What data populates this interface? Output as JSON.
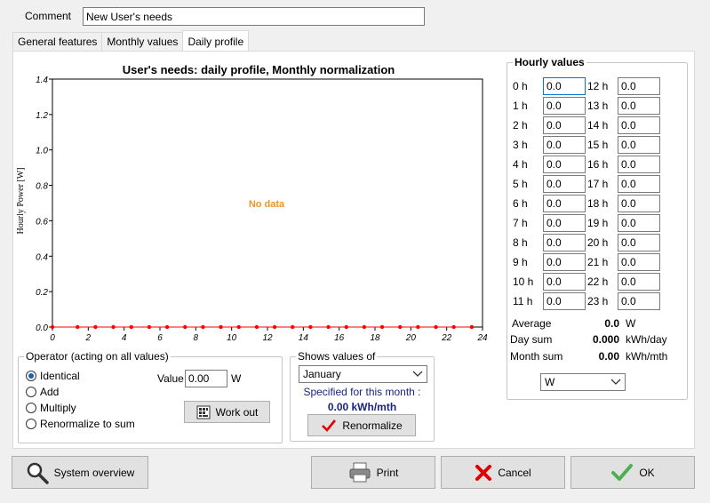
{
  "comment": {
    "label": "Comment",
    "value": "New User's needs"
  },
  "tabs": [
    {
      "label": "General features"
    },
    {
      "label": "Monthly values"
    },
    {
      "label": "Daily profile"
    }
  ],
  "chart_data": {
    "type": "line",
    "title": "User's needs: daily profile, Monthly normalization",
    "xlabel": "",
    "ylabel": "Hourly Power [W]",
    "xlim": [
      0,
      24
    ],
    "ylim": [
      0.0,
      1.4
    ],
    "x_ticks": [
      "0",
      "2",
      "4",
      "6",
      "8",
      "10",
      "12",
      "14",
      "16",
      "18",
      "20",
      "22",
      "24"
    ],
    "y_ticks": [
      "0.0",
      "0.2",
      "0.4",
      "0.6",
      "0.8",
      "1.0",
      "1.2",
      "1.4"
    ],
    "annotation": "No data",
    "series": [
      {
        "x": [
          0,
          1.4,
          2.4,
          3.4,
          4.4,
          5.4,
          6.4,
          7.4,
          8.4,
          9.4,
          10.4,
          11.4,
          12.4,
          13.4,
          14.4,
          15.4,
          16.4,
          17.4,
          18.4,
          19.4,
          20.4,
          21.4,
          22.4,
          23.4
        ],
        "values": [
          0,
          0,
          0,
          0,
          0,
          0,
          0,
          0,
          0,
          0,
          0,
          0,
          0,
          0,
          0,
          0,
          0,
          0,
          0,
          0,
          0,
          0,
          0,
          0
        ],
        "color": "#ff0000"
      }
    ]
  },
  "operator": {
    "title": "Operator (acting on all values)",
    "options": [
      "Identical",
      "Add",
      "Multiply",
      "Renormalize to sum"
    ],
    "selected": 0,
    "value_label": "Value",
    "value": "0.00",
    "unit": "W",
    "work_out": "Work out"
  },
  "shows": {
    "title": "Shows values of",
    "month": "January",
    "specified_label": "Specified for this month :",
    "specified_value": "0.00 kWh/mth",
    "renormalize": "Renormalize"
  },
  "hourly": {
    "title": "Hourly values",
    "labels": [
      "0 h",
      "1 h",
      "2 h",
      "3 h",
      "4 h",
      "5 h",
      "6 h",
      "7 h",
      "8 h",
      "9 h",
      "10 h",
      "11 h",
      "12 h",
      "13 h",
      "14 h",
      "15 h",
      "16 h",
      "17 h",
      "18 h",
      "19 h",
      "20 h",
      "21 h",
      "22 h",
      "23 h"
    ],
    "values": [
      "0.0",
      "0.0",
      "0.0",
      "0.0",
      "0.0",
      "0.0",
      "0.0",
      "0.0",
      "0.0",
      "0.0",
      "0.0",
      "0.0",
      "0.0",
      "0.0",
      "0.0",
      "0.0",
      "0.0",
      "0.0",
      "0.0",
      "0.0",
      "0.0",
      "0.0",
      "0.0",
      "0.0"
    ],
    "average_label": "Average",
    "average_value": "0.0",
    "average_unit": "W",
    "daysum_label": "Day sum",
    "daysum_value": "0.000",
    "daysum_unit": "kWh/day",
    "monthsum_label": "Month sum",
    "monthsum_value": "0.00",
    "monthsum_unit": "kWh/mth",
    "unit_select": "W"
  },
  "buttons": {
    "system_overview": "System overview",
    "print": "Print",
    "cancel": "Cancel",
    "ok": "OK"
  },
  "colors": {
    "no_data": "#f0961e",
    "specified_value": "#1a237e",
    "specified_label": "#1a237e",
    "red": "#e00000",
    "ok_green": "#4caf50"
  }
}
